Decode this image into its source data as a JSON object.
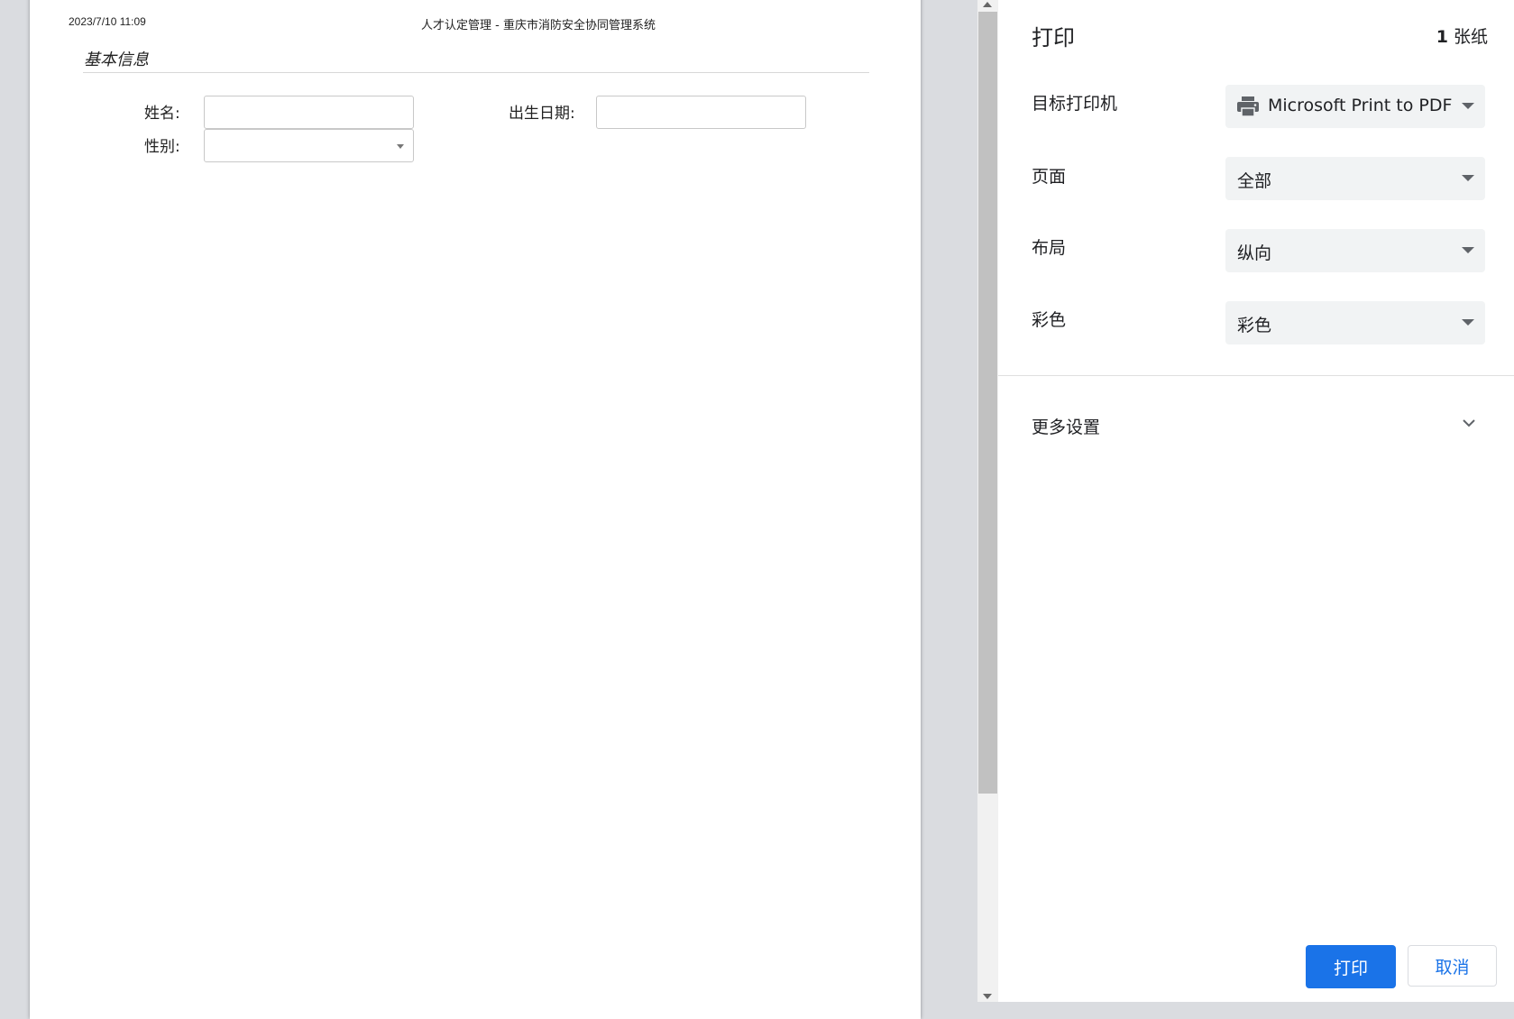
{
  "preview": {
    "header_date": "2023/7/10 11:09",
    "header_title": "人才认定管理 - 重庆市消防安全协同管理系统",
    "section_title": "基本信息",
    "fields": {
      "name_label": "姓名:",
      "birth_label": "出生日期:",
      "gender_label": "性别:",
      "name_value": "",
      "birth_value": "",
      "gender_value": ""
    }
  },
  "panel": {
    "title": "打印",
    "sheet_count_num": "1",
    "sheet_count_unit": "张纸",
    "rows": {
      "destination_label": "目标打印机",
      "destination_value": "Microsoft Print to PDF",
      "pages_label": "页面",
      "pages_value": "全部",
      "layout_label": "布局",
      "layout_value": "纵向",
      "color_label": "彩色",
      "color_value": "彩色"
    },
    "more_settings": "更多设置",
    "print_button": "打印",
    "cancel_button": "取消"
  },
  "colors": {
    "accent": "#1a73e8",
    "preview_bg": "#dadce0",
    "dropdown_bg": "#f1f3f4"
  },
  "icons": [
    "printer-icon",
    "chevron-down-icon",
    "dropdown-caret-icon"
  ]
}
